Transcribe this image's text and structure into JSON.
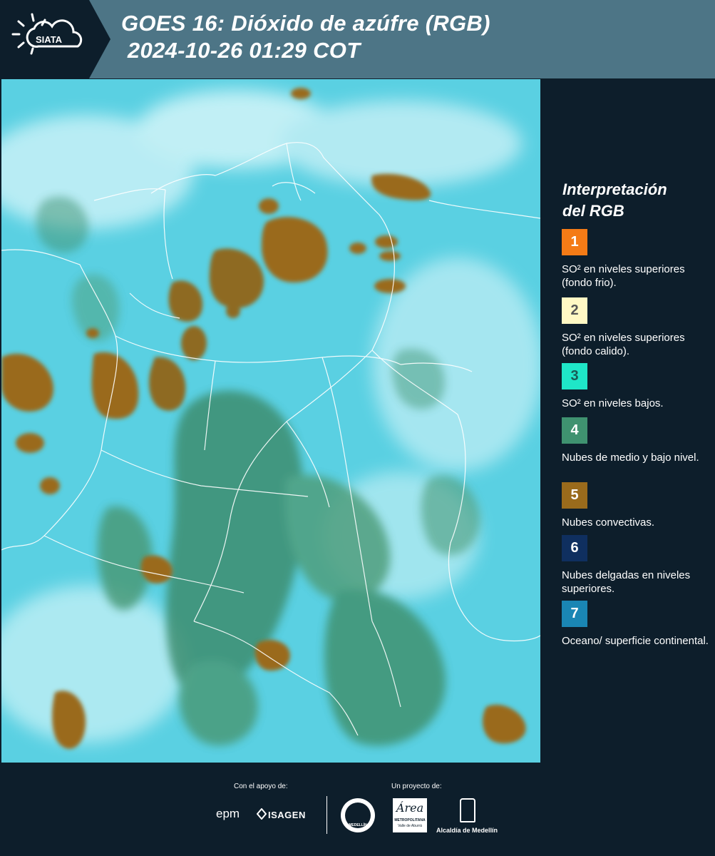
{
  "header": {
    "brand": "SIATA",
    "title_line1": "GOES 16: Dióxido de azúfre (RGB)",
    "title_line2": " 2024-10-26 01:29 COT"
  },
  "legend": {
    "title_line1": "Interpretación",
    "title_line2": "del RGB",
    "items": [
      {
        "number": "1",
        "label": "SO² en niveles superiores (fondo frio).",
        "color": "#f47b16",
        "text_color": "#ffffff"
      },
      {
        "number": "2",
        "label": "SO² en niveles superiores (fondo calido).",
        "color": "#fff8c4",
        "text_color": "#555555"
      },
      {
        "number": "3",
        "label": "SO² en niveles bajos.",
        "color": "#1fe6c8",
        "text_color": "#1a5a55"
      },
      {
        "number": "4",
        "label": "Nubes de medio y bajo nivel.",
        "color": "#3f9270",
        "text_color": "#ffffff"
      },
      {
        "number": "5",
        "label": "Nubes convectivas.",
        "color": "#9a6b1c",
        "text_color": "#ffffff"
      },
      {
        "number": "6",
        "label": "Nubes delgadas en niveles superiores.",
        "color": "#0f2f5f",
        "text_color": "#ffffff"
      },
      {
        "number": "7",
        "label": "Oceano/ superficie continental.",
        "color": "#1a86b4",
        "text_color": "#ffffff"
      }
    ]
  },
  "footer": {
    "support_label": "Con el apoyo de:",
    "project_label": "Un proyecto de:",
    "sponsor1": "epm",
    "sponsor2": "ISAGEN",
    "partner1_line1": "Área",
    "partner1_line2": "METROPOLITANA",
    "partner1_line3": "Valle de Aburrá",
    "partner2": "Alcaldía de Medellín",
    "seal_text": "MEDELLÍN"
  },
  "colors": {
    "header_bg": "#4d7586",
    "panel_bg": "#0d1e2b",
    "map_background": "#5ad0e2",
    "convective_cloud": "#9a6b1c",
    "low_cloud": "#3f9270"
  }
}
